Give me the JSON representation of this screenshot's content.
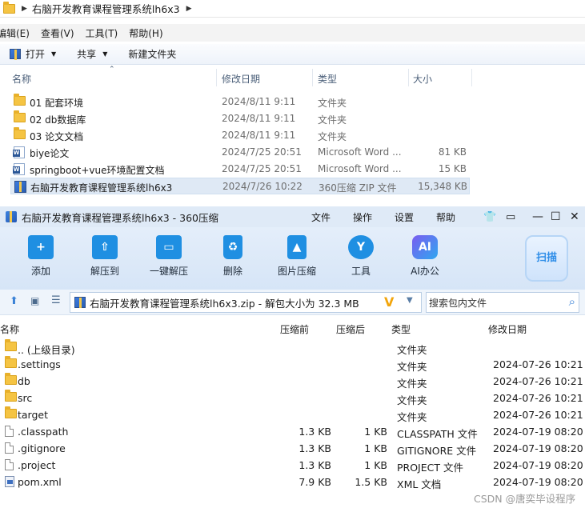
{
  "explorer": {
    "breadcrumb": "右脑开发教育课程管理系统lh6x3",
    "menu": [
      "编辑(E)",
      "查看(V)",
      "工具(T)",
      "帮助(H)"
    ],
    "toolbar": {
      "open": "打开",
      "share": "共享",
      "new_folder": "新建文件夹"
    },
    "columns": {
      "name": "名称",
      "date": "修改日期",
      "type": "类型",
      "size": "大小"
    },
    "rows": [
      {
        "icon": "folder-icon",
        "name": "01 配套环境",
        "date": "2024/8/11 9:11",
        "type": "文件夹",
        "size": ""
      },
      {
        "icon": "folder-icon",
        "name": "02 db数据库",
        "date": "2024/8/11 9:11",
        "type": "文件夹",
        "size": ""
      },
      {
        "icon": "folder-icon",
        "name": "03 论文文档",
        "date": "2024/8/11 9:11",
        "type": "文件夹",
        "size": ""
      },
      {
        "icon": "word-doc-icon",
        "name": "biye论文",
        "date": "2024/7/25 20:51",
        "type": "Microsoft Word ...",
        "size": "81 KB"
      },
      {
        "icon": "word-doc-icon",
        "name": "springboot+vue环境配置文档",
        "date": "2024/7/25 20:51",
        "type": "Microsoft Word ...",
        "size": "15 KB"
      },
      {
        "icon": "zip-archive-icon",
        "name": "右脑开发教育课程管理系统lh6x3",
        "date": "2024/7/26 10:22",
        "type": "360压缩 ZIP 文件",
        "size": "15,348 KB"
      }
    ]
  },
  "zip": {
    "title": "右脑开发教育课程管理系统lh6x3 - 360压缩",
    "menu": [
      "文件",
      "操作",
      "设置",
      "帮助"
    ],
    "tools": [
      {
        "icon": "add-icon",
        "label": "添加"
      },
      {
        "icon": "extract-to-icon",
        "label": "解压到"
      },
      {
        "icon": "one-click-extract-icon",
        "label": "一键解压"
      },
      {
        "icon": "delete-icon",
        "label": "删除"
      },
      {
        "icon": "image-compress-icon",
        "label": "图片压缩"
      },
      {
        "icon": "tools-icon",
        "label": "工具"
      },
      {
        "icon": "ai-office-icon",
        "label": "AI办公"
      }
    ],
    "scan_label": "扫描",
    "path": "右脑开发教育课程管理系统lh6x3.zip - 解包大小为 32.3 MB",
    "search_placeholder": "搜索包内文件",
    "columns": {
      "name": "名称",
      "compressed_before": "压缩前",
      "compressed_after": "压缩后",
      "type": "类型",
      "date": "修改日期"
    },
    "rows": [
      {
        "icon": "folder-icon",
        "name": ".. (上级目录)",
        "before": "",
        "after": "",
        "type": "文件夹",
        "date": ""
      },
      {
        "icon": "folder-icon",
        "name": ".settings",
        "before": "",
        "after": "",
        "type": "文件夹",
        "date": "2024-07-26 10:21"
      },
      {
        "icon": "folder-icon",
        "name": "db",
        "before": "",
        "after": "",
        "type": "文件夹",
        "date": "2024-07-26 10:21"
      },
      {
        "icon": "folder-icon",
        "name": "src",
        "before": "",
        "after": "",
        "type": "文件夹",
        "date": "2024-07-26 10:21"
      },
      {
        "icon": "folder-icon",
        "name": "target",
        "before": "",
        "after": "",
        "type": "文件夹",
        "date": "2024-07-26 10:21"
      },
      {
        "icon": "file-icon",
        "name": ".classpath",
        "before": "1.3 KB",
        "after": "1 KB",
        "type": "CLASSPATH 文件",
        "date": "2024-07-19 08:20"
      },
      {
        "icon": "file-icon",
        "name": ".gitignore",
        "before": "1.3 KB",
        "after": "1 KB",
        "type": "GITIGNORE 文件",
        "date": "2024-07-19 08:20"
      },
      {
        "icon": "file-icon",
        "name": ".project",
        "before": "1.3 KB",
        "after": "1 KB",
        "type": "PROJECT 文件",
        "date": "2024-07-19 08:20"
      },
      {
        "icon": "xml-file-icon",
        "name": "pom.xml",
        "before": "7.9 KB",
        "after": "1.5 KB",
        "type": "XML 文档",
        "date": "2024-07-19 08:20"
      }
    ]
  },
  "watermark": "CSDN @唐奕毕设程序"
}
